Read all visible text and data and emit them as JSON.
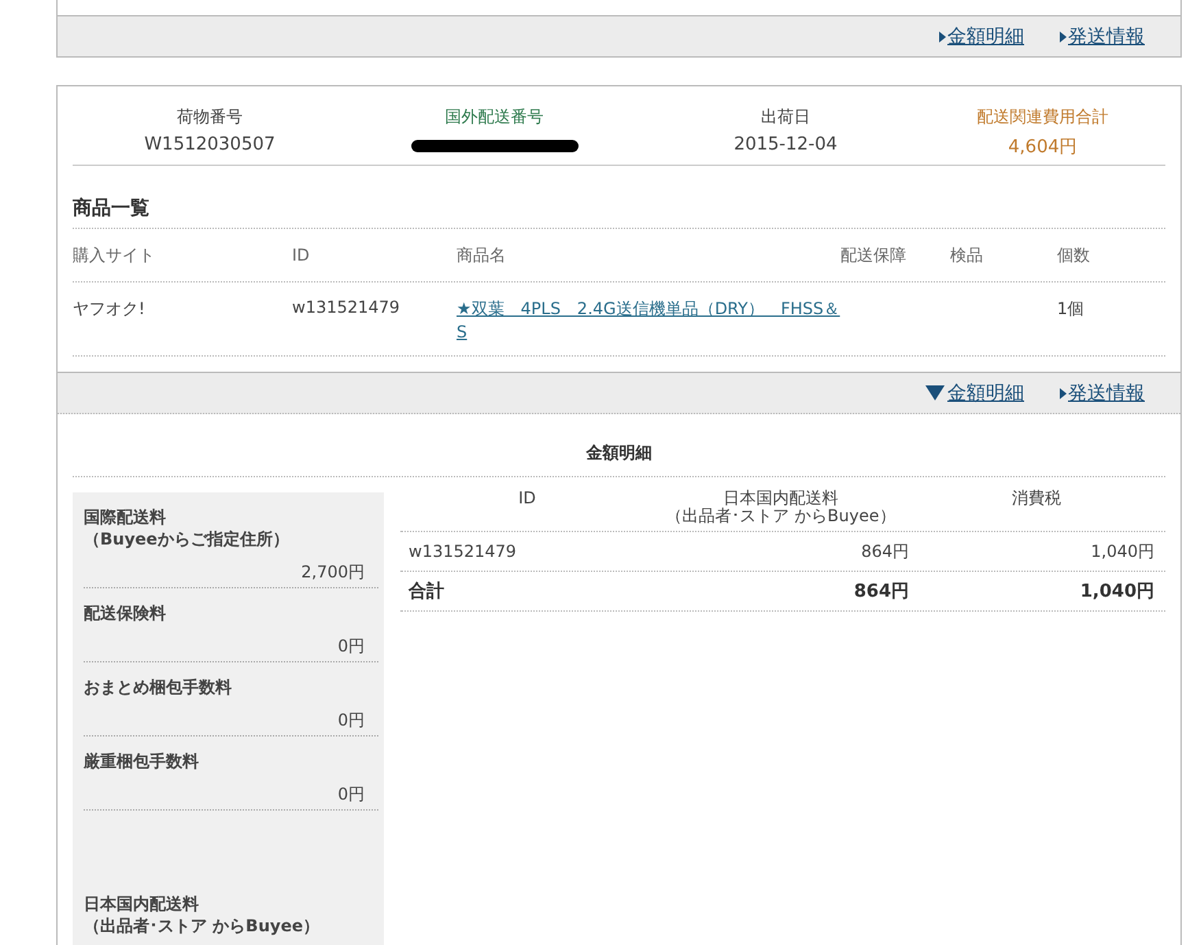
{
  "top_panel": {
    "links": [
      {
        "label": "金額明細",
        "expanded": false
      },
      {
        "label": "発送情報",
        "expanded": false
      }
    ]
  },
  "shipment": {
    "summary": [
      {
        "label": "荷物番号",
        "value": "W1512030507",
        "kind": "plain"
      },
      {
        "label": "国外配送番号",
        "kind": "redacted"
      },
      {
        "label": "出荷日",
        "value": "2015-12-04",
        "kind": "plain"
      },
      {
        "label": "配送関連費用合計",
        "value": "4,604円",
        "kind": "cost"
      }
    ],
    "products_title": "商品一覧",
    "products_columns": [
      "購入サイト",
      "ID",
      "商品名",
      "配送保障",
      "検品",
      "個数"
    ],
    "products_rows": [
      [
        "ヤフオク!",
        "w131521479",
        "★双葉　4PLS　2.4G送信機単品（DRY）　FHSS＆S",
        "",
        "",
        "1個"
      ]
    ],
    "links": [
      {
        "label": "金額明細",
        "expanded": true
      },
      {
        "label": "発送情報",
        "expanded": false
      }
    ]
  },
  "amount_detail": {
    "title": "金額明細",
    "fees": [
      {
        "label": [
          "国際配送料",
          "（Buyeeからご指定住所）"
        ],
        "amount": "2,700円"
      },
      {
        "label": [
          "配送保険料"
        ],
        "amount": "0円"
      },
      {
        "label": [
          "おまとめ梱包手数料"
        ],
        "amount": "0円"
      },
      {
        "label": [
          "厳重梱包手数料"
        ],
        "amount": "0円"
      },
      {
        "label": [
          "日本国内配送料",
          "（出品者･ストア からBuyee）"
        ]
      }
    ],
    "columns": [
      {
        "label": "ID"
      },
      {
        "label": "日本国内配送料",
        "note": "（出品者･ストア からBuyee）"
      },
      {
        "label": "消費税"
      }
    ],
    "rows": [
      {
        "cells": [
          "w131521479",
          "864円",
          "1,040円"
        ],
        "total": false
      },
      {
        "cells": [
          "合計",
          "864円",
          "1,040円"
        ],
        "total": true
      }
    ]
  }
}
